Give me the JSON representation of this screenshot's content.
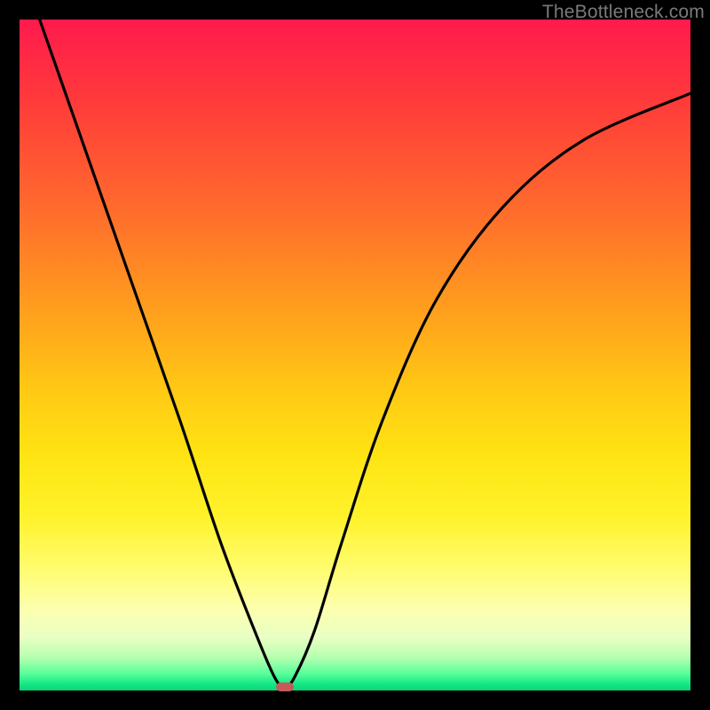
{
  "watermark": "TheBottleneck.com",
  "chart_data": {
    "type": "line",
    "title": "",
    "xlabel": "",
    "ylabel": "",
    "xlim": [
      0,
      100
    ],
    "ylim": [
      0,
      100
    ],
    "grid": false,
    "series": [
      {
        "name": "curve",
        "x": [
          3,
          10,
          17,
          24,
          30,
          35,
          38,
          39.5,
          41,
          44,
          48,
          54,
          62,
          72,
          84,
          100
        ],
        "values": [
          100,
          80,
          60,
          40,
          22,
          9,
          2,
          0.5,
          2,
          9,
          22,
          40,
          58,
          72,
          82,
          89
        ]
      }
    ],
    "marker": {
      "x": 39.5,
      "y": 0.5,
      "color": "#c55b59"
    },
    "background_gradient": [
      "#ff1a4d",
      "#ffe413",
      "#0ad47a"
    ]
  }
}
